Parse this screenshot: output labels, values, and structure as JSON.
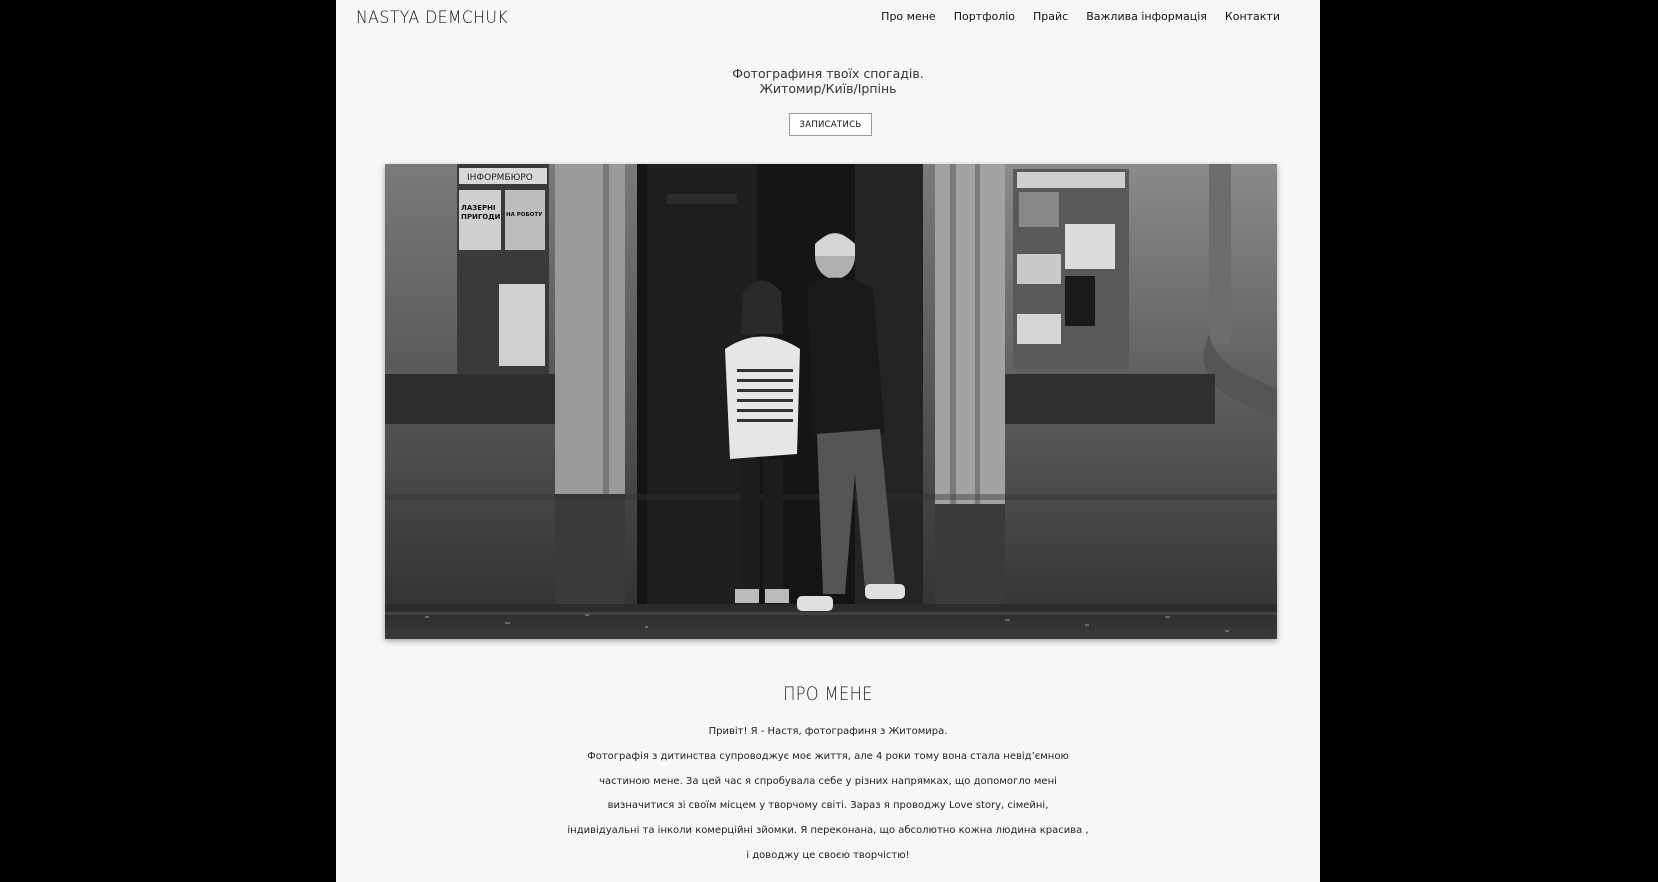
{
  "header": {
    "logo": "NASTYA DEMCHUK",
    "nav": [
      {
        "label": "Про мене"
      },
      {
        "label": "Портфоліо"
      },
      {
        "label": "Прайс"
      },
      {
        "label": "Важлива інформація"
      },
      {
        "label": "Контакти"
      }
    ]
  },
  "hero": {
    "tagline_line1": "Фотографиня твоїх спогадів.",
    "tagline_line2": "Житомир/Київ/Ірпінь",
    "cta_label": "ЗАПИСАТИСЬ"
  },
  "photo": {
    "poster_left_top": "ІНФОРМБЮРО",
    "poster_left_1": "ЛАЗЕРНІ ПРИГОДИ",
    "poster_left_2": "НА РОБОТУ"
  },
  "about": {
    "title": "ПРО МЕНЕ",
    "lines": [
      "Привіт! Я - Настя, фотографиня з Житомира.",
      "Фотографія з дитинства супроводжує моє життя, але 4 роки тому вона стала невід’ємною",
      "частиною мене. За цей час я спробувала себе у різних напрямках, що допомогло мені",
      "визначитися зі своїм місцем у творчому світі. Зараз я проводжу Love story, сімейні,",
      "індивідуальні та інколи комерційні зйомки. Я переконана, що абсолютно кожна людина красива ,",
      "і доводжу це своєю творчістю!"
    ]
  },
  "colors": {
    "page_background": "#f7f7f7",
    "outer_background": "#000000",
    "text": "#222222"
  }
}
